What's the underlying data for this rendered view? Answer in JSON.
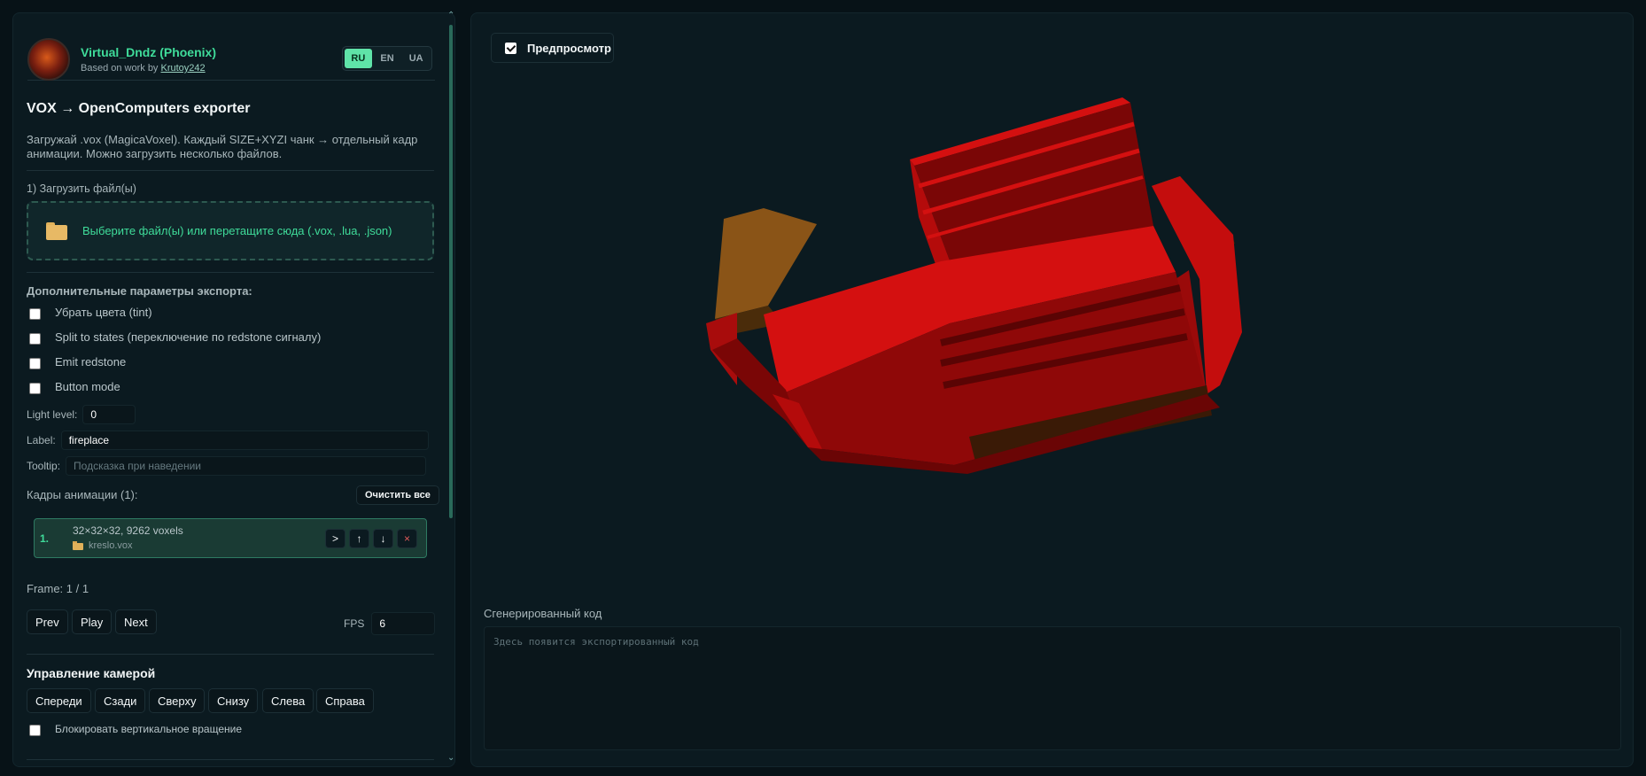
{
  "header": {
    "author": "Virtual_Dndz (Phoenix)",
    "based_prefix": "Based on work by",
    "based_link": "Krutoy242",
    "langs": [
      "RU",
      "EN",
      "UA"
    ],
    "active_lang": "RU"
  },
  "intro": {
    "title": "VOX → OpenComputers exporter",
    "description": "Загружай .vox (MagicaVoxel). Каждый SIZE+XYZI чанк → отдельный кадр анимации. Можно загрузить несколько файлов."
  },
  "upload": {
    "step": "1) Загрузить файл(ы)",
    "dropzone_text": "Выберите файл(ы) или перетащите сюда (.vox, .lua, .json)"
  },
  "options": {
    "heading": "Дополнительные параметры экспорта:",
    "checkboxes": [
      {
        "label": "Убрать цвета (tint)",
        "checked": false
      },
      {
        "label": "Split to states (переключение по redstone сигналу)",
        "checked": false
      },
      {
        "label": "Emit redstone",
        "checked": false
      },
      {
        "label": "Button mode",
        "checked": false
      }
    ],
    "light_label": "Light level:",
    "light_value": "0",
    "label_label": "Label:",
    "label_value": "fireplace",
    "tooltip_label": "Tooltip:",
    "tooltip_placeholder": "Подсказка при наведении"
  },
  "frames": {
    "heading": "Кадры анимации (1):",
    "clear_label": "Очистить все",
    "items": [
      {
        "num": "1.",
        "info": "32×32×32, 9262 voxels",
        "file": "kreslo.vox"
      }
    ],
    "btn_labels": [
      ">",
      "↑",
      "↓",
      "×"
    ]
  },
  "playback": {
    "frame_text": "Frame: 1 / 1",
    "prev": "Prev",
    "play": "Play",
    "next": "Next",
    "fps_label": "FPS",
    "fps_value": "6"
  },
  "camera": {
    "heading": "Управление камерой",
    "buttons": [
      "Спереди",
      "Сзади",
      "Сверху",
      "Снизу",
      "Слева",
      "Справа"
    ],
    "lock_label": "Блокировать вертикальное вращение"
  },
  "preview": {
    "toggle_label": "Предпросмотр",
    "checked": true
  },
  "code": {
    "label": "Сгенерированный код",
    "placeholder": "Здесь появится экспортированный код"
  },
  "colors": {
    "accent": "#3fdc9a",
    "armchair_red": "#d40f0f",
    "armchair_wood": "#8a5417"
  }
}
